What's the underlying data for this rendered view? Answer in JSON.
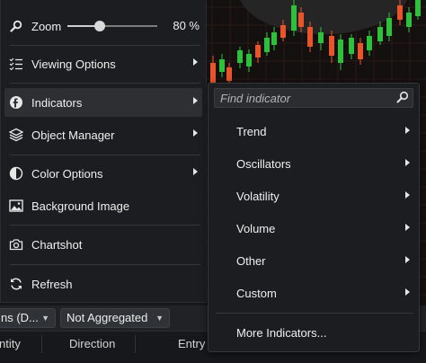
{
  "main_menu": {
    "zoom": {
      "label": "Zoom",
      "value_text": "80 %",
      "level_percent": 80
    },
    "items": [
      {
        "label": "Viewing Options",
        "icon": "list-checks-icon"
      },
      {
        "label": "Indicators",
        "icon": "indicators-icon",
        "active": true
      },
      {
        "label": "Object Manager",
        "icon": "layers-icon"
      },
      {
        "label": "Color Options",
        "icon": "palette-icon"
      },
      {
        "label": "Background Image",
        "icon": "image-icon"
      },
      {
        "label": "Chartshot",
        "icon": "camera-icon"
      },
      {
        "label": "Refresh",
        "icon": "refresh-icon"
      }
    ]
  },
  "indicators_submenu": {
    "search_placeholder": "Find indicator",
    "items": [
      "Trend",
      "Oscillators",
      "Volatility",
      "Volume",
      "Other",
      "Custom"
    ],
    "more_label": "More Indicators..."
  },
  "toolbar": {
    "select_left_value": "ns (D...",
    "select_aggregation_value": "Not Aggregated"
  },
  "table_header": {
    "columns": [
      "ntity",
      "Direction",
      "Entry"
    ]
  },
  "colors": {
    "menu_bg": "#1c1d20",
    "active_item_bg": "#2d2f33",
    "candle_up": "#2fbf3c",
    "candle_down": "#e8552b"
  }
}
